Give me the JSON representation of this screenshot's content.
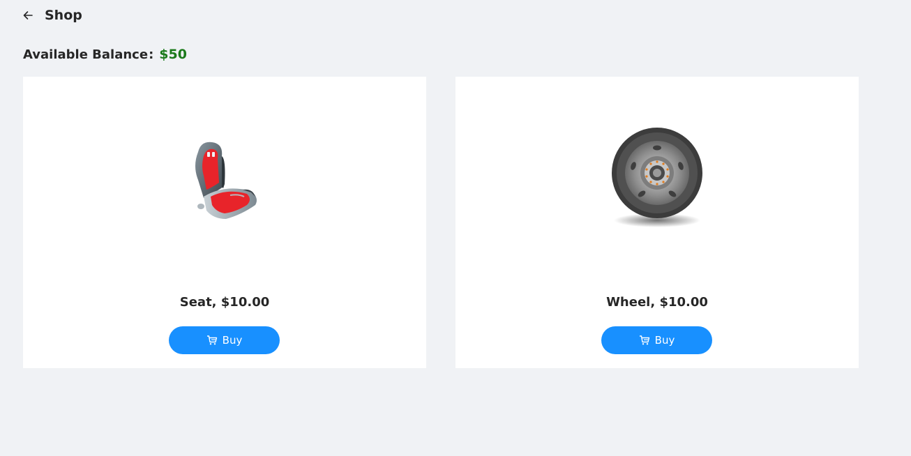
{
  "header": {
    "back_icon": "arrow-left-icon",
    "title": "Shop"
  },
  "balance": {
    "label": "Available Balance",
    "colon": ":",
    "value": "$50",
    "value_color": "#1b7a1b"
  },
  "products": [
    {
      "name": "Seat, $10.00",
      "image": "racing-seat-image",
      "buy_label": "Buy",
      "buy_icon": "shopping-cart-icon"
    },
    {
      "name": "Wheel, $10.00",
      "image": "wheel-image",
      "buy_label": "Buy",
      "buy_icon": "shopping-cart-icon"
    }
  ],
  "colors": {
    "background": "#f0f2f5",
    "card": "#ffffff",
    "primary": "#1890ff"
  }
}
